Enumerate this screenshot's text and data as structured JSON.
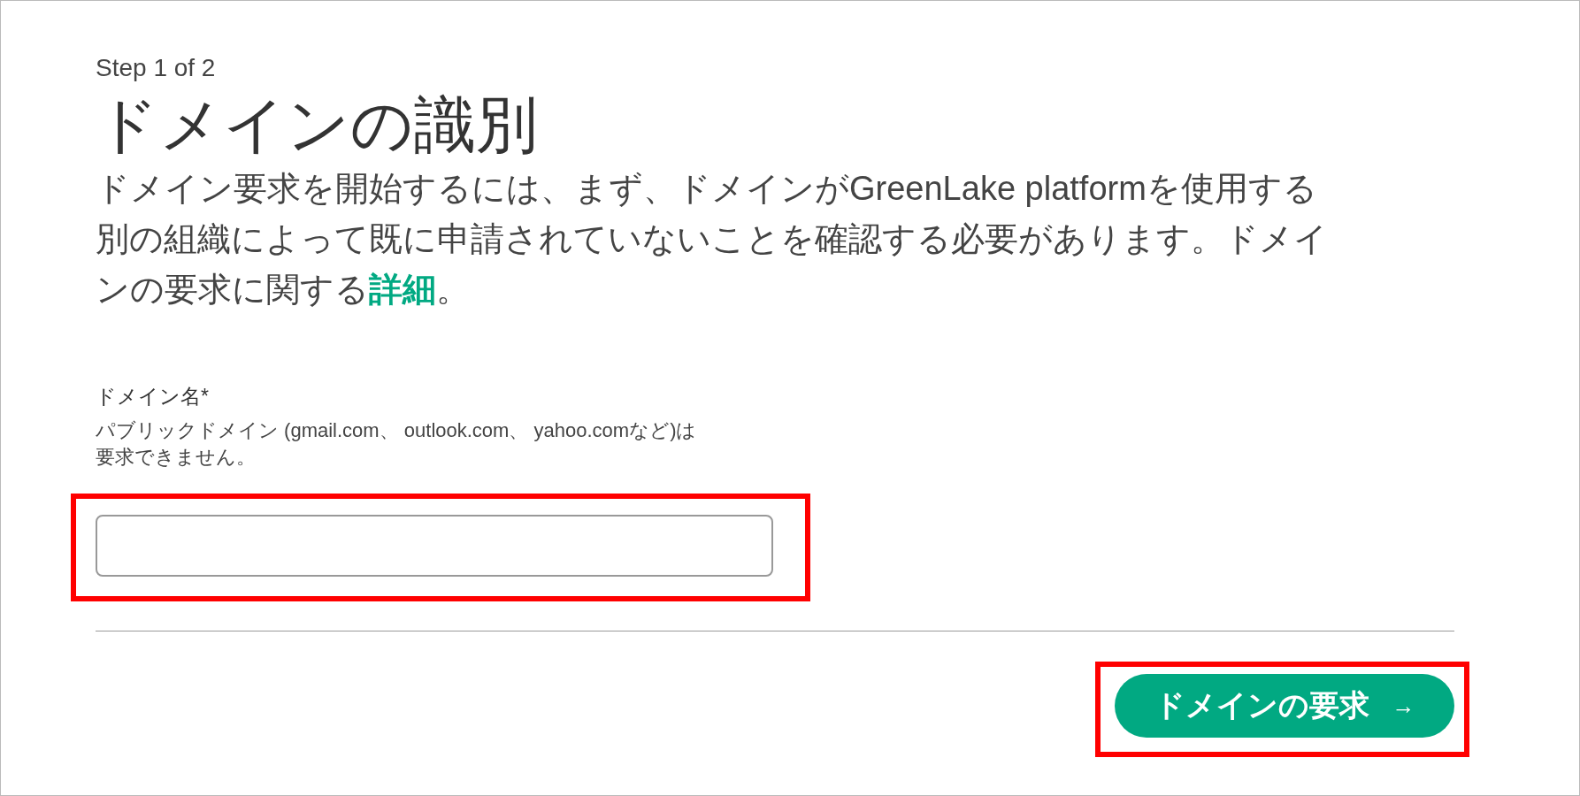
{
  "step": "Step 1 of 2",
  "title": "ドメインの識別",
  "description": {
    "text": "ドメイン要求を開始するには、まず、ドメインがGreenLake platformを使用する別の組織によって既に申請されていないことを確認する必要があります。ドメインの要求に関する",
    "link": "詳細",
    "end": "。"
  },
  "field": {
    "label": "ドメイン名*",
    "hint": [
      "パブリックドメイン (gmail.com、 outlook.com、 yahoo.comなど)は",
      "要求できません。"
    ],
    "highlighted": true
  },
  "button": {
    "label": "ドメインの要求",
    "icon": "→",
    "highlighted": true
  }
}
